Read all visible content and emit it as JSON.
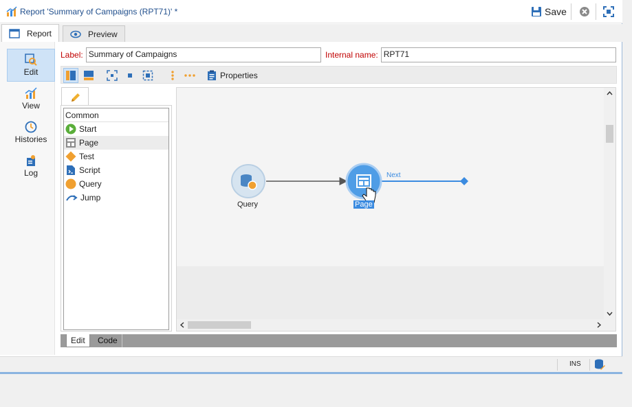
{
  "window": {
    "title": "Report 'Summary of Campaigns (RPT71)' *",
    "save_label": "Save"
  },
  "tabs": [
    {
      "label": "Report",
      "icon": "report-icon"
    },
    {
      "label": "Preview",
      "icon": "eye-icon"
    }
  ],
  "sidebar": {
    "items": [
      {
        "label": "Edit",
        "icon": "edit-magnifier-icon",
        "active": true
      },
      {
        "label": "View",
        "icon": "chart-icon"
      },
      {
        "label": "Histories",
        "icon": "clock-icon"
      },
      {
        "label": "Log",
        "icon": "log-icon"
      }
    ]
  },
  "form": {
    "label_caption": "Label:",
    "label_value": "Summary of Campaigns",
    "internal_caption": "Internal name:",
    "internal_value": "RPT71"
  },
  "toolbar": {
    "properties_label": "Properties"
  },
  "palette": {
    "group": "Common",
    "items": [
      {
        "label": "Start",
        "icon": "start-icon"
      },
      {
        "label": "Page",
        "icon": "page-icon"
      },
      {
        "label": "Test",
        "icon": "test-diamond-icon"
      },
      {
        "label": "Script",
        "icon": "script-icon"
      },
      {
        "label": "Query",
        "icon": "query-icon"
      },
      {
        "label": "Jump",
        "icon": "jump-icon"
      }
    ]
  },
  "diagram": {
    "nodes": [
      {
        "label": "Query"
      },
      {
        "label": "Page"
      }
    ],
    "edge_label": "Next"
  },
  "bottom_tabs": [
    "Edit",
    "Code"
  ],
  "status": {
    "mode": "INS"
  },
  "colors": {
    "accent": "#3b8be0",
    "required_label": "#c00000",
    "query_node": "#d6e4f0",
    "page_node": "#4f9de6"
  }
}
